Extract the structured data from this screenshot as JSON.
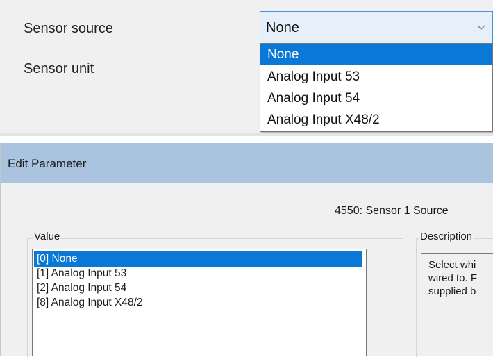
{
  "sensor_settings": {
    "source_label": "Sensor source",
    "unit_label": "Sensor unit",
    "source_value": "None",
    "source_options": [
      "None",
      "Analog Input 53",
      "Analog Input 54",
      "Analog Input X48/2"
    ],
    "selected_index": 0
  },
  "dialog": {
    "title": "Edit Parameter",
    "parameter_name": "4550: Sensor 1 Source",
    "value_group_label": "Value",
    "values": [
      "[0] None",
      "[1] Analog Input 53",
      "[2] Analog Input 54",
      "[8] Analog Input X48/2"
    ],
    "selected_value_index": 0,
    "description_group_label": "Description",
    "description_lines": [
      "Select whi",
      "wired to. F",
      "supplied b"
    ]
  },
  "colors": {
    "selection": "#0a78d6",
    "title_bar": "#aac3df",
    "combo_focus_border": "#4a8fd8"
  }
}
